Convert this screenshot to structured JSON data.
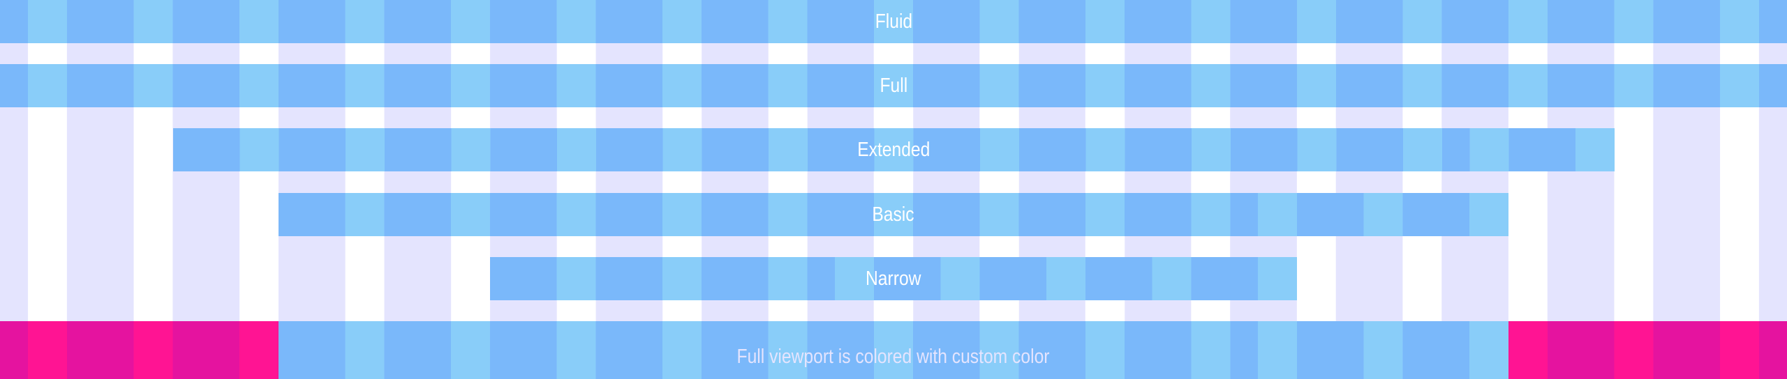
{
  "rows": {
    "fluid": "Fluid",
    "full": "Full",
    "extended": "Extended",
    "basic": "Basic",
    "narrow": "Narrow",
    "viewport": "Full viewport is colored with custom color"
  },
  "colors": {
    "column_blue": "#7ab8fa",
    "gutter_blue": "#89cdf9",
    "column_lavender": "#e4e4fe",
    "gutter_white": "#ffffff",
    "custom_pink_column": "#e5139f",
    "custom_pink_gutter": "#ff1493"
  }
}
